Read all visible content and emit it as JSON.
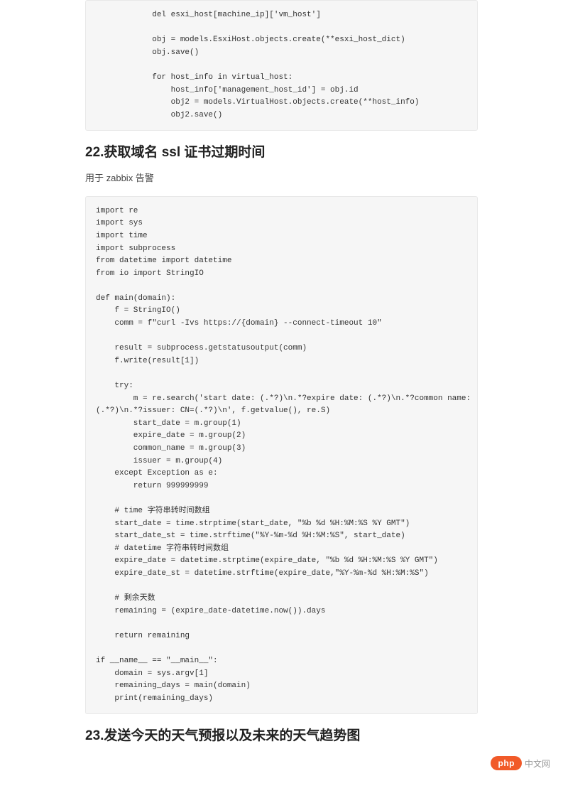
{
  "code_block_1": "            del esxi_host[machine_ip]['vm_host']\n\n            obj = models.EsxiHost.objects.create(**esxi_host_dict)\n            obj.save()\n\n            for host_info in virtual_host:\n                host_info['management_host_id'] = obj.id\n                obj2 = models.VirtualHost.objects.create(**host_info)\n                obj2.save()",
  "heading_22": "22.获取域名 ssl 证书过期时间",
  "paragraph_22": "用于 zabbix 告警",
  "code_block_2": "import re\nimport sys\nimport time\nimport subprocess\nfrom datetime import datetime\nfrom io import StringIO\n\ndef main(domain):\n    f = StringIO()\n    comm = f\"curl -Ivs https://{domain} --connect-timeout 10\"\n\n    result = subprocess.getstatusoutput(comm)\n    f.write(result[1])\n\n    try:\n        m = re.search('start date: (.*?)\\n.*?expire date: (.*?)\\n.*?common name:\n(.*?)\\n.*?issuer: CN=(.*?)\\n', f.getvalue(), re.S)\n        start_date = m.group(1)\n        expire_date = m.group(2)\n        common_name = m.group(3)\n        issuer = m.group(4)\n    except Exception as e:\n        return 999999999\n\n    # time 字符串转时间数组\n    start_date = time.strptime(start_date, \"%b %d %H:%M:%S %Y GMT\")\n    start_date_st = time.strftime(\"%Y-%m-%d %H:%M:%S\", start_date)\n    # datetime 字符串转时间数组\n    expire_date = datetime.strptime(expire_date, \"%b %d %H:%M:%S %Y GMT\")\n    expire_date_st = datetime.strftime(expire_date,\"%Y-%m-%d %H:%M:%S\")\n\n    # 剩余天数\n    remaining = (expire_date-datetime.now()).days\n\n    return remaining\n\nif __name__ == \"__main__\":\n    domain = sys.argv[1]\n    remaining_days = main(domain)\n    print(remaining_days)",
  "heading_23": "23.发送今天的天气预报以及未来的天气趋势图",
  "watermark": {
    "badge": "php",
    "text": "中文网"
  }
}
